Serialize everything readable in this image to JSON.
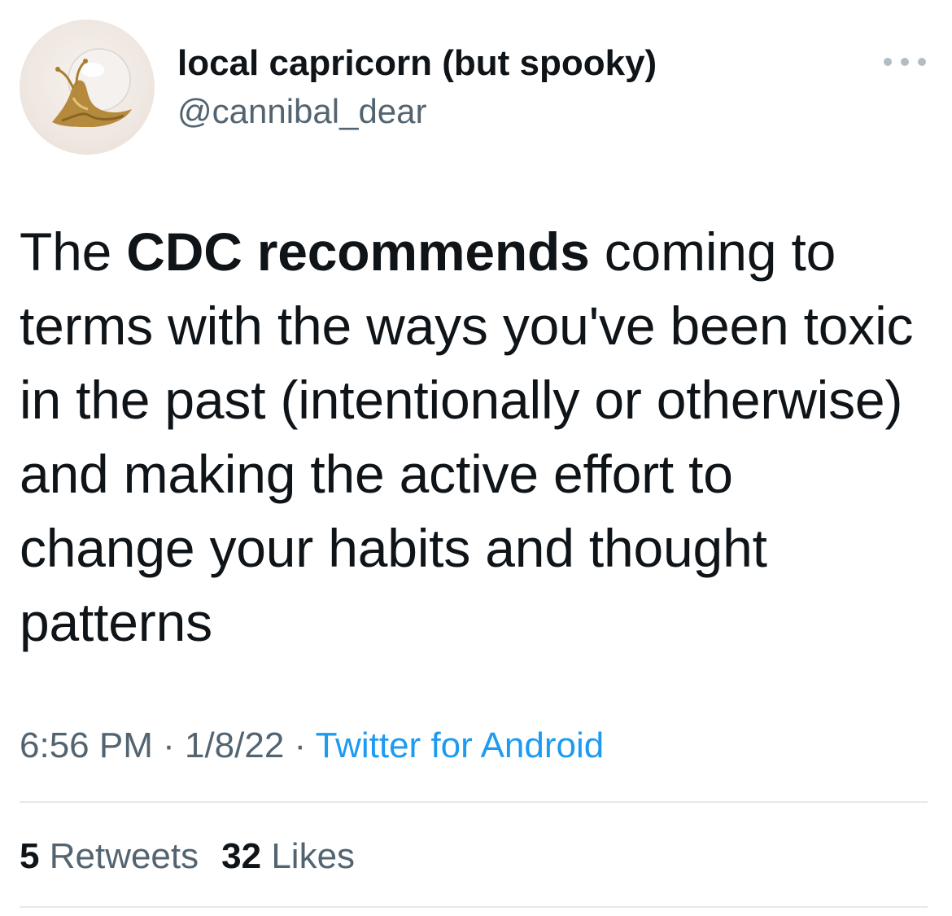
{
  "user": {
    "display_name": "local capricorn (but spooky)",
    "handle": "@cannibal_dear",
    "avatar_icon": "snail-figurine-icon"
  },
  "tweet": {
    "text_part1": "The ",
    "text_bold": "CDC recommends",
    "text_part2": " coming to terms with the ways you've been toxic in the past (intentionally or otherwise) and making the active effort to change your habits and thought patterns"
  },
  "meta": {
    "time": "6:56 PM",
    "sep1": " · ",
    "date": "1/8/22",
    "sep2": " · ",
    "source": "Twitter for Android"
  },
  "stats": {
    "retweets_count": "5",
    "retweets_label": "Retweets",
    "likes_count": "32",
    "likes_label": "Likes"
  },
  "colors": {
    "text": "#0f1419",
    "secondary": "#536471",
    "link": "#1d9bf0",
    "divider": "#e6e9eb"
  }
}
